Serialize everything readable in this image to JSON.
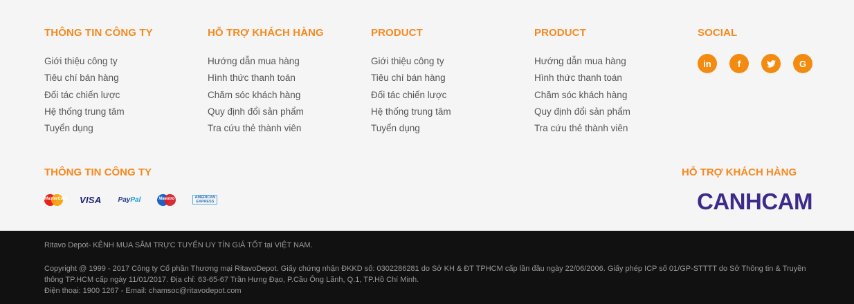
{
  "columns": [
    {
      "title": "THÔNG TIN CÔNG TY",
      "links": [
        "Giới thiệu công ty",
        "Tiêu chí bán hàng",
        "Đối tác chiến lược",
        "Hệ thống trung tâm",
        "Tuyển dụng"
      ]
    },
    {
      "title": "HỖ TRỢ KHÁCH HÀNG",
      "links": [
        "Hướng dẫn mua hàng",
        "Hình thức thanh toán",
        "Chăm sóc khách hàng",
        "Quy định đổi sản phẩm",
        "Tra cứu thẻ thành viên"
      ]
    },
    {
      "title": "PRODUCT",
      "links": [
        "Giới thiệu công ty",
        "Tiêu chí bán hàng",
        "Đối tác chiến lược",
        "Hệ thống trung tâm",
        "Tuyển dụng"
      ]
    },
    {
      "title": "PRODUCT",
      "links": [
        "Hướng dẫn mua hàng",
        "Hình thức thanh toán",
        "Chăm sóc khách hàng",
        "Quy định đổi sản phẩm",
        "Tra cứu thẻ thành viên"
      ]
    }
  ],
  "social": {
    "title": "SOCIAL",
    "icons": [
      {
        "name": "linkedin-icon",
        "glyph": "in"
      },
      {
        "name": "facebook-icon",
        "glyph": "f"
      },
      {
        "name": "twitter-icon",
        "glyph": "🐦"
      },
      {
        "name": "google-icon",
        "glyph": "G"
      }
    ]
  },
  "payments": {
    "title": "THÔNG TIN CÔNG TY",
    "mastercard": "MasterCard",
    "visa": "VISA",
    "paypal_1": "Pay",
    "paypal_2": "Pal",
    "maestro": "Maestro",
    "amex": "AMERICAN EXPRESS"
  },
  "support": {
    "title": "HỖ TRỢ KHÁCH HÀNG",
    "logo": "CANHCAM"
  },
  "footer": {
    "tagline": "Ritavo Depot- KÊNH MUA SẮM TRỰC TUYẾN UY TÍN GIÁ TỐT tại VIỆT NAM.",
    "copyright": "Copyright @ 1999 - 2017 Công ty Cổ phần Thương mại RitavoDepot. Giấy chứng nhận ĐKKD số: 0302286281 do Sở KH & ĐT TPHCM cấp lần đầu ngày 22/06/2006. Giấy phép ICP số 01/GP-STTTT do Sở Thông tin & Truyền thông TP.HCM cấp ngày 11/01/2017. Địa chỉ: 63-65-67 Trần Hưng Đạo, P.Cầu Ông Lãnh, Q.1, TP.Hồ Chí Minh.",
    "contact": "Điện thoại: 1900 1267 - Email: chamsoc@ritavodepot.com"
  },
  "colors": {
    "accent": "#f5891f",
    "logo": "#3d2a8a",
    "bottom_bg": "#111111"
  }
}
